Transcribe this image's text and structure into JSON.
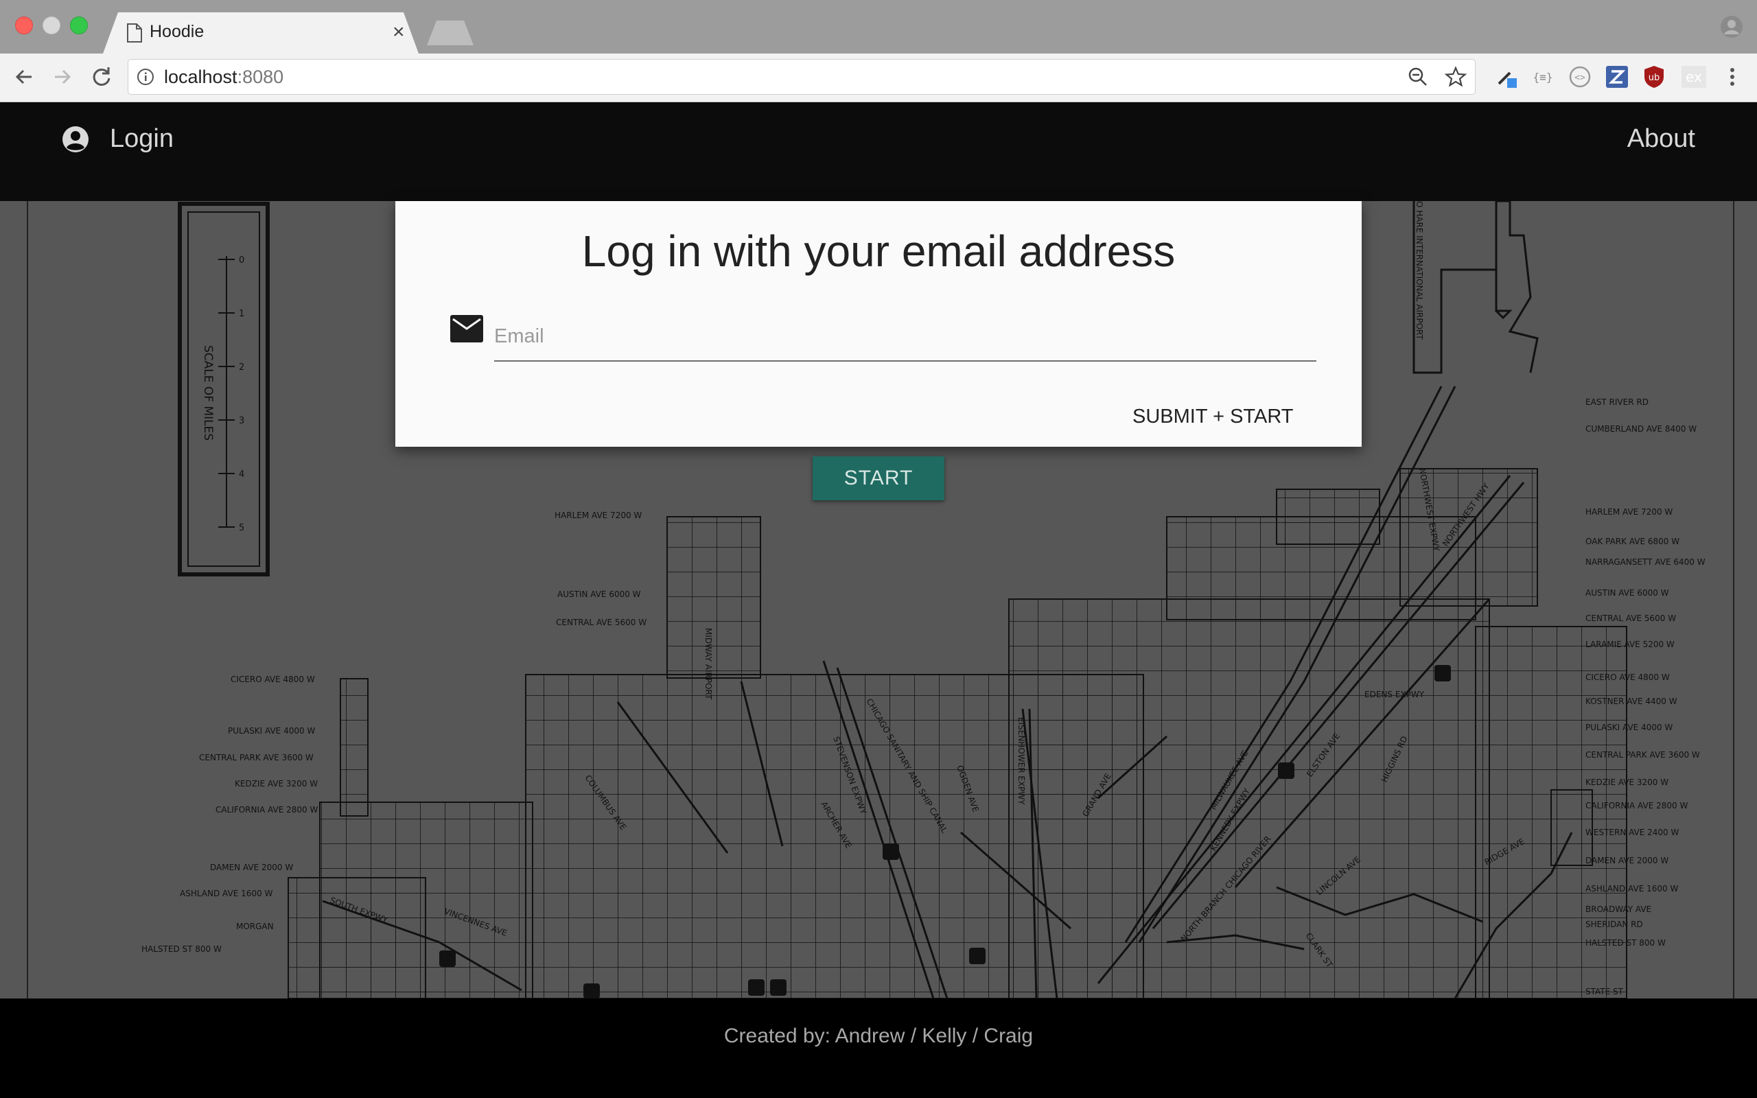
{
  "browser": {
    "tab_title": "Hoodie",
    "tab_close": "×",
    "url_host": "localhost",
    "url_port": ":8080"
  },
  "header": {
    "login_label": "Login",
    "about_label": "About"
  },
  "modal": {
    "title": "Log in with your email address",
    "email_placeholder": "Email",
    "submit_label": "SUBMIT + START"
  },
  "start_button": "START",
  "footer": {
    "credits": "Created by: Andrew / Kelly / Craig"
  },
  "map": {
    "scale_label": "SCALE OF MILES",
    "scale_ticks": [
      "0",
      "1",
      "2",
      "3",
      "4",
      "5"
    ],
    "left_labels": [
      "HARLEM AVE 7200 W",
      "AUSTIN AVE 6000 W",
      "CENTRAL AVE 5600 W",
      "CICERO AVE 4800 W",
      "PULASKI AVE 4000 W",
      "CENTRAL PARK AVE 3600 W",
      "KEDZIE AVE 3200 W",
      "CALIFORNIA AVE 2800 W",
      "DAMEN AVE 2000 W",
      "ASHLAND AVE 1600 W",
      "MORGAN",
      "HALSTED ST 800 W"
    ],
    "right_labels": [
      "EAST RIVER RD",
      "CUMBERLAND AVE 8400 W",
      "HARLEM AVE 7200 W",
      "OAK PARK AVE 6800 W",
      "NARRAGANSETT AVE 6400 W",
      "AUSTIN AVE 6000 W",
      "CENTRAL AVE 5600 W",
      "LARAMIE AVE 5200 W",
      "CICERO AVE 4800 W",
      "KOSTNER AVE 4400 W",
      "PULASKI AVE 4000 W",
      "CENTRAL PARK AVE 3600 W",
      "KEDZIE AVE 3200 W",
      "CALIFORNIA AVE 2800 W",
      "WESTERN AVE 2400 W",
      "DAMEN AVE 2000 W",
      "ASHLAND AVE 1600 W",
      "BROADWAY AVE",
      "SHERIDAN RD",
      "HALSTED ST 800 W",
      "STATE ST"
    ],
    "street_labels": [
      "MIDWAY AIRPORT",
      "CHICAGO SANITARY AND SHIP CANAL",
      "STEVENSON EXPWY",
      "ARCHER AVE",
      "COLUMBUS AVE",
      "OGDEN AVE",
      "EISENHOWER EXPWY",
      "GRAND AVE",
      "MILWAUKEE AVE",
      "KENNEDY EXPWY",
      "NORTHWEST EXPWY",
      "NORTHWEST HWY",
      "HIGGINS RD",
      "EDENS EXPWY",
      "ELSTON AVE",
      "LINCOLN AVE",
      "RIDGE AVE",
      "CLARK ST",
      "NORTH BRANCH CHICAGO RIVER",
      "SOUTH EXPWY",
      "VINCENNES AVE",
      "O HARE INTERNATIONAL AIRPORT"
    ]
  },
  "colors": {
    "header_bg": "#0c0c0c",
    "start_button_bg": "#1f6b61",
    "modal_bg": "#fafafa"
  }
}
